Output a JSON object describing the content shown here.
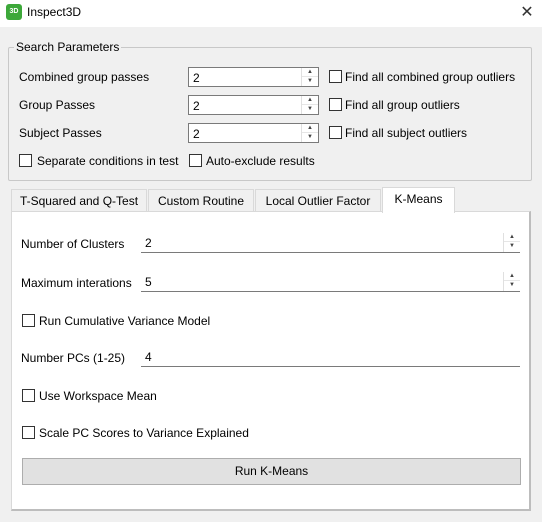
{
  "window": {
    "title": "Inspect3D",
    "icon_text": "3D",
    "close_glyph": "✕"
  },
  "search": {
    "group_title": "Search Parameters",
    "combined_label": "Combined group passes",
    "combined_value": "2",
    "group_label": "Group Passes",
    "group_value": "2",
    "subject_label": "Subject Passes",
    "subject_value": "2",
    "find_combined": "Find all combined group outliers",
    "find_group": "Find all group outliers",
    "find_subject": "Find all subject outliers",
    "separate_conditions": "Separate conditions in test",
    "auto_exclude": "Auto-exclude results"
  },
  "tabs": [
    {
      "label": "T-Squared and Q-Test"
    },
    {
      "label": "Custom Routine"
    },
    {
      "label": "Local Outlier Factor"
    },
    {
      "label": "K-Means"
    }
  ],
  "kmeans": {
    "clusters_label": "Number of Clusters",
    "clusters_value": "2",
    "max_iter_label": "Maximum interations",
    "max_iter_value": "5",
    "cumulative_label": "Run Cumulative Variance Model",
    "pcs_label": "Number PCs (1-25)",
    "pcs_value": "4",
    "workspace_mean_label": "Use Workspace Mean",
    "scale_pc_label": "Scale PC Scores to Variance Explained",
    "run_button": "Run K-Means"
  },
  "icons": {
    "spin_up": "▲",
    "spin_down": "▼"
  }
}
